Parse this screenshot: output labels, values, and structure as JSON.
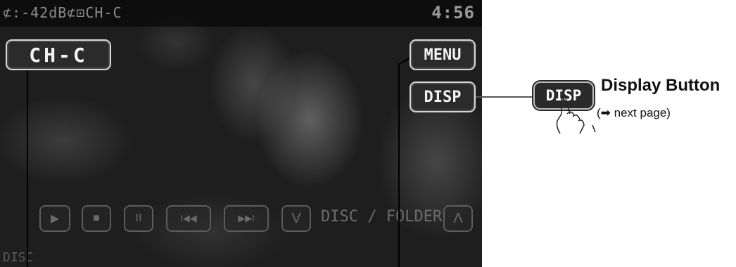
{
  "screen": {
    "status": {
      "left_text": "⊄:-42dB⊄⊡CH-C",
      "clock": "4:56"
    },
    "source_button": {
      "label": "CH-C"
    },
    "menu_button": {
      "label": "MENU"
    },
    "disp_button": {
      "label": "DISP"
    },
    "controls": [
      {
        "name": "play",
        "glyph": "▶"
      },
      {
        "name": "stop",
        "glyph": "■"
      },
      {
        "name": "pause",
        "glyph": "II"
      },
      {
        "name": "previous",
        "glyph": "I◀◀"
      },
      {
        "name": "next",
        "glyph": "▶▶I"
      },
      {
        "name": "disc-down",
        "glyph": "V"
      },
      {
        "name": "disc-up",
        "glyph": "Λ"
      }
    ],
    "disc_folder_label": "DISC / FOLDER",
    "bottom_left_text": "DISC"
  },
  "callout": {
    "button_label": "DISP",
    "title": "Display Button",
    "subtitle": "(➡ next page)"
  },
  "colors": {
    "screen_bg": "#1e1e1e",
    "button_border": "#d8d8d8",
    "text_dark": "#111111"
  }
}
